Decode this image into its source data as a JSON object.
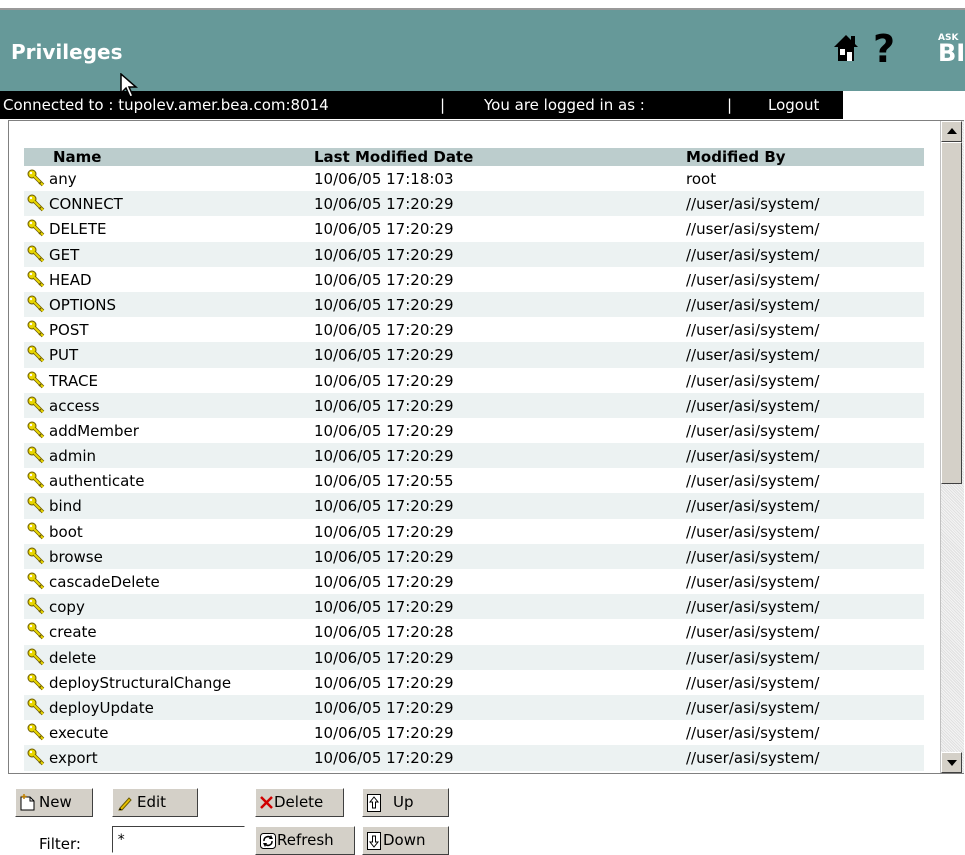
{
  "header": {
    "title": "Privileges",
    "brand_small": "ASK",
    "brand_big": "BI",
    "help_glyph": "?"
  },
  "statusbar": {
    "connected_to": "Connected to : tupolev.amer.bea.com:8014",
    "sep1": "|",
    "logged_in_as": "You are logged in as :",
    "sep2": "|",
    "logout": "Logout"
  },
  "table": {
    "columns": [
      "Name",
      "Last Modified Date",
      "Modified By"
    ],
    "rows": [
      [
        "any",
        "10/06/05 17:18:03",
        "root"
      ],
      [
        "CONNECT",
        "10/06/05 17:20:29",
        "//user/asi/system/"
      ],
      [
        "DELETE",
        "10/06/05 17:20:29",
        "//user/asi/system/"
      ],
      [
        "GET",
        "10/06/05 17:20:29",
        "//user/asi/system/"
      ],
      [
        "HEAD",
        "10/06/05 17:20:29",
        "//user/asi/system/"
      ],
      [
        "OPTIONS",
        "10/06/05 17:20:29",
        "//user/asi/system/"
      ],
      [
        "POST",
        "10/06/05 17:20:29",
        "//user/asi/system/"
      ],
      [
        "PUT",
        "10/06/05 17:20:29",
        "//user/asi/system/"
      ],
      [
        "TRACE",
        "10/06/05 17:20:29",
        "//user/asi/system/"
      ],
      [
        "access",
        "10/06/05 17:20:29",
        "//user/asi/system/"
      ],
      [
        "addMember",
        "10/06/05 17:20:29",
        "//user/asi/system/"
      ],
      [
        "admin",
        "10/06/05 17:20:29",
        "//user/asi/system/"
      ],
      [
        "authenticate",
        "10/06/05 17:20:55",
        "//user/asi/system/"
      ],
      [
        "bind",
        "10/06/05 17:20:29",
        "//user/asi/system/"
      ],
      [
        "boot",
        "10/06/05 17:20:29",
        "//user/asi/system/"
      ],
      [
        "browse",
        "10/06/05 17:20:29",
        "//user/asi/system/"
      ],
      [
        "cascadeDelete",
        "10/06/05 17:20:29",
        "//user/asi/system/"
      ],
      [
        "copy",
        "10/06/05 17:20:29",
        "//user/asi/system/"
      ],
      [
        "create",
        "10/06/05 17:20:28",
        "//user/asi/system/"
      ],
      [
        "delete",
        "10/06/05 17:20:29",
        "//user/asi/system/"
      ],
      [
        "deployStructuralChange",
        "10/06/05 17:20:29",
        "//user/asi/system/"
      ],
      [
        "deployUpdate",
        "10/06/05 17:20:29",
        "//user/asi/system/"
      ],
      [
        "execute",
        "10/06/05 17:20:29",
        "//user/asi/system/"
      ],
      [
        "export",
        "10/06/05 17:20:29",
        "//user/asi/system/"
      ]
    ]
  },
  "toolbar": {
    "new_label": "New",
    "edit_label": "Edit",
    "delete_label": "Delete",
    "up_label": "Up",
    "refresh_label": "Refresh",
    "down_label": "Down"
  },
  "filter": {
    "label": "Filter:",
    "value": "*"
  },
  "icons": {
    "home": "home-icon",
    "help": "help-icon",
    "key": "key-icon",
    "new": "new-document-icon",
    "edit": "pencil-icon",
    "delete": "delete-x-icon",
    "up": "arrow-up-icon",
    "down": "arrow-down-icon",
    "refresh": "refresh-icon"
  },
  "colors": {
    "header_bg": "#669999",
    "statusbar_bg": "#000000",
    "table_header_bg": "#bccdcd",
    "row_alt_bg": "#ecf2f2",
    "button_face": "#d4d0c8",
    "key_yellow": "#e8d600",
    "delete_red": "#d00000"
  }
}
